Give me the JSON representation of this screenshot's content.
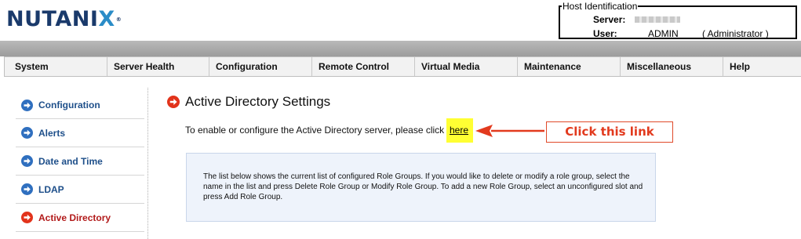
{
  "brand": {
    "logo_main": "NUTANI",
    "logo_x": "X",
    "logo_mark": "®"
  },
  "host": {
    "legend": "Host Identification",
    "server_label": "Server:",
    "user_label": "User:",
    "user_value": "ADMIN",
    "user_role": "( Administrator )"
  },
  "nav": {
    "tabs": [
      {
        "label": "System"
      },
      {
        "label": "Server Health"
      },
      {
        "label": "Configuration"
      },
      {
        "label": "Remote Control"
      },
      {
        "label": "Virtual Media"
      },
      {
        "label": "Maintenance"
      },
      {
        "label": "Miscellaneous"
      },
      {
        "label": "Help"
      }
    ]
  },
  "sidebar": {
    "items": [
      {
        "label": "Configuration",
        "active": false
      },
      {
        "label": "Alerts",
        "active": false
      },
      {
        "label": "Date and Time",
        "active": false
      },
      {
        "label": "LDAP",
        "active": false
      },
      {
        "label": "Active Directory",
        "active": true
      }
    ]
  },
  "main": {
    "title": "Active Directory Settings",
    "intro_text": "To enable or configure the Active Directory server, please click",
    "link_text": "here",
    "callout": "Click this link",
    "info_text": "The list below shows the current list of configured Role Groups. If you would like to delete or modify a role group, select the name in the list and press Delete Role Group or Modify Role Group. To add a new Role Group, select an unconfigured slot and press Add Role Group."
  },
  "colors": {
    "brand_blue": "#1a3a6b",
    "brand_x": "#2a8cc7",
    "link_blue": "#1e4f8a",
    "active_red": "#b21a1a",
    "annotation_red": "#e23a1e",
    "highlight_yellow": "#ffff33"
  }
}
